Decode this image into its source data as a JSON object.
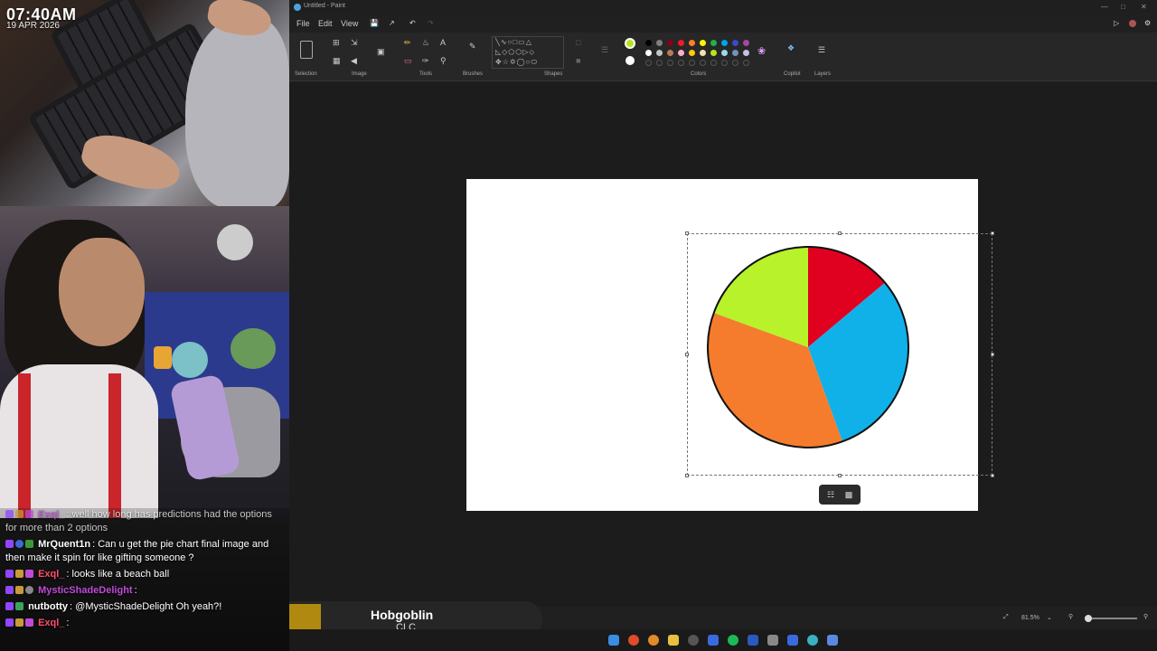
{
  "overlay": {
    "clock": "07:40AM",
    "date": "19 APR 2026"
  },
  "chat": [
    {
      "user": "Exql_",
      "user_color": "#c04ad8",
      "text": ": well how long has predictions had the options for more than 2 options",
      "faded": true
    },
    {
      "user": "MrQuent1n",
      "user_color": "#ffffff",
      "text": ": Can u get the pie chart final image and then make it spin for like gifting someone ?"
    },
    {
      "user": "Exql_",
      "user_color": "#ff4d6d",
      "text": ": looks like a beach ball"
    },
    {
      "user": "MysticShadeDelight",
      "user_color": "#c04ad8",
      "text": ":"
    },
    {
      "user": "nutbotty",
      "user_color": "#ffffff",
      "text": ": @MysticShadeDelight Oh yeah?!"
    },
    {
      "user": "Exql_",
      "user_color": "#ff4d6d",
      "text": ":"
    }
  ],
  "now_playing": {
    "title": "Hobgoblin",
    "artist": "CLC"
  },
  "paint": {
    "window_title": "Untitled - Paint",
    "menu": [
      "File",
      "Edit",
      "View"
    ],
    "groups": [
      "Selection",
      "Image",
      "Tools",
      "Brushes",
      "Shapes",
      "Colors",
      "Copilot",
      "Layers"
    ],
    "zoom": "81.5%",
    "palette_row1": [
      "#000000",
      "#7f7f7f",
      "#880015",
      "#ed1c24",
      "#ff7f27",
      "#fff200",
      "#22b14c",
      "#00a2e8",
      "#3f48cc",
      "#a349a4"
    ],
    "palette_row2": [
      "#ffffff",
      "#c3c3c3",
      "#b97a57",
      "#ffaec9",
      "#ffc90e",
      "#efe4b0",
      "#b5e61d",
      "#99d9ea",
      "#7092be",
      "#c8bfe7"
    ],
    "primary_color": "#b5e61d",
    "secondary_color": "#ffffff"
  },
  "pie": {
    "slices": [
      {
        "color": "#e0001f",
        "start": 0,
        "end": 50
      },
      {
        "color": "#10b0e8",
        "start": 50,
        "end": 160
      },
      {
        "color": "#f47c2c",
        "start": 160,
        "end": 290
      },
      {
        "color": "#b8f22a",
        "start": 290,
        "end": 360
      }
    ]
  }
}
